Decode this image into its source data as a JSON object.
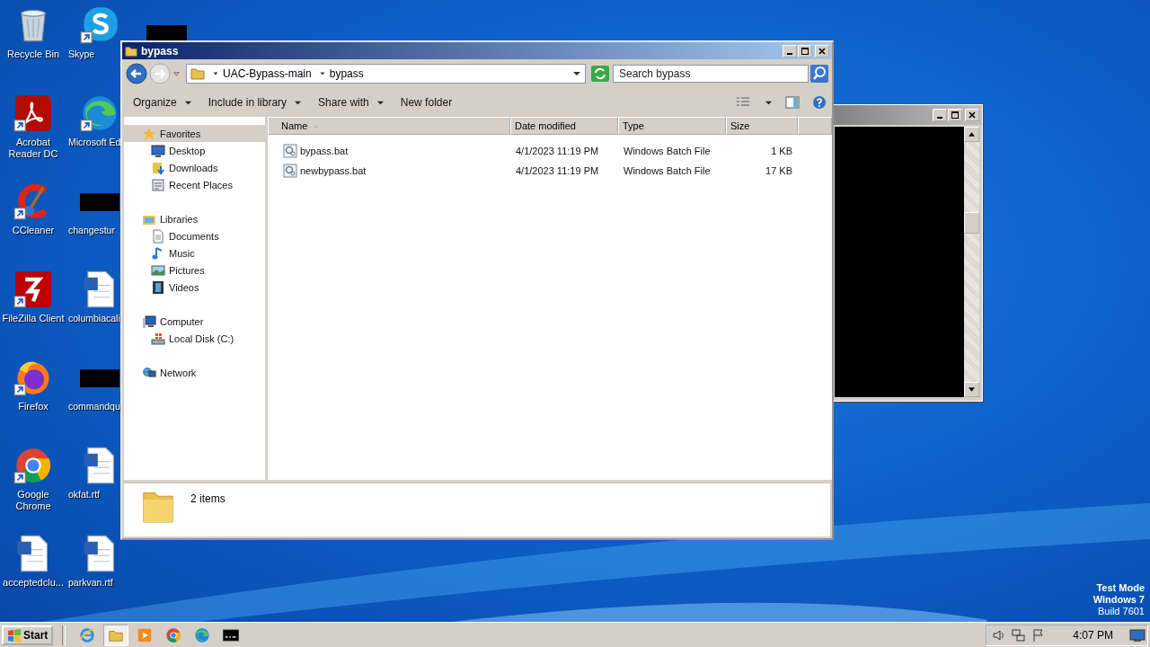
{
  "desktop": {
    "icon_columns": [
      [
        {
          "label": "Recycle Bin",
          "kind": "recycle",
          "shortcut": false
        },
        {
          "label": "Acrobat Reader DC",
          "kind": "acrobat",
          "shortcut": true
        },
        {
          "label": "CCleaner",
          "kind": "ccleaner",
          "shortcut": true
        },
        {
          "label": "FileZilla Client",
          "kind": "filezilla",
          "shortcut": true
        },
        {
          "label": "Firefox",
          "kind": "firefox",
          "shortcut": true
        },
        {
          "label": "Google Chrome",
          "kind": "chrome",
          "shortcut": true
        },
        {
          "label": "acceptedclu...",
          "kind": "document",
          "shortcut": false
        }
      ],
      [
        {
          "label": "Skype",
          "kind": "skype",
          "shortcut": true
        },
        {
          "label": "Microsoft Ed",
          "kind": "edge",
          "shortcut": true
        },
        {
          "label": "changestur",
          "kind": "redacted",
          "shortcut": false
        },
        {
          "label": "columbiacali",
          "kind": "document",
          "shortcut": false
        },
        {
          "label": "commandqu",
          "kind": "redacted",
          "shortcut": false
        },
        {
          "label": "okfat.rtf",
          "kind": "document",
          "shortcut": false
        },
        {
          "label": "parkvan.rtf",
          "kind": "document",
          "shortcut": false
        }
      ]
    ],
    "os_notice": [
      "Test Mode",
      "Windows 7",
      "Build 7601"
    ]
  },
  "console_window": {
    "focused": false
  },
  "explorer": {
    "title": "bypass",
    "breadcrumb": [
      "UAC-Bypass-main",
      "bypass"
    ],
    "search": {
      "placeholder": "Search bypass"
    },
    "toolbar": [
      {
        "label": "Organize",
        "dropdown": true
      },
      {
        "label": "Include in library",
        "dropdown": true
      },
      {
        "label": "Share with",
        "dropdown": true
      },
      {
        "label": "New folder",
        "dropdown": false
      }
    ],
    "nav": [
      {
        "label": "Favorites",
        "kind": "star",
        "selected": true,
        "children": [
          {
            "label": "Desktop",
            "kind": "monitor",
            "selected": false
          },
          {
            "label": "Downloads",
            "kind": "downloads",
            "selected": false
          },
          {
            "label": "Recent Places",
            "kind": "recent",
            "selected": false
          }
        ]
      },
      {
        "label": "Libraries",
        "kind": "library",
        "selected": false,
        "children": [
          {
            "label": "Documents",
            "kind": "page",
            "selected": false
          },
          {
            "label": "Music",
            "kind": "note",
            "selected": false
          },
          {
            "label": "Pictures",
            "kind": "image",
            "selected": false
          },
          {
            "label": "Videos",
            "kind": "film",
            "selected": false
          }
        ]
      },
      {
        "label": "Computer",
        "kind": "computer",
        "selected": false,
        "children": [
          {
            "label": "Local Disk (C:)",
            "kind": "disk",
            "selected": false
          }
        ]
      },
      {
        "label": "Network",
        "kind": "network",
        "selected": false
      }
    ],
    "columns": [
      {
        "label": "Name",
        "sorted": true
      },
      {
        "label": "Date modified",
        "sorted": false
      },
      {
        "label": "Type",
        "sorted": false
      },
      {
        "label": "Size",
        "sorted": false
      }
    ],
    "rows": [
      [
        "bypass.bat",
        "4/1/2023 11:19 PM",
        "Windows Batch File",
        "1 KB"
      ],
      [
        "newbypass.bat",
        "4/1/2023 11:19 PM",
        "Windows Batch File",
        "17 KB"
      ]
    ],
    "status": "2 items"
  },
  "taskbar": {
    "start": "Start",
    "apps": [
      {
        "kind": "ie",
        "active": false
      },
      {
        "kind": "folder",
        "active": true
      },
      {
        "kind": "media",
        "active": false
      },
      {
        "kind": "chrome",
        "active": false
      },
      {
        "kind": "edge",
        "active": false
      },
      {
        "kind": "console",
        "active": false
      }
    ],
    "clock": "4:07 PM"
  }
}
